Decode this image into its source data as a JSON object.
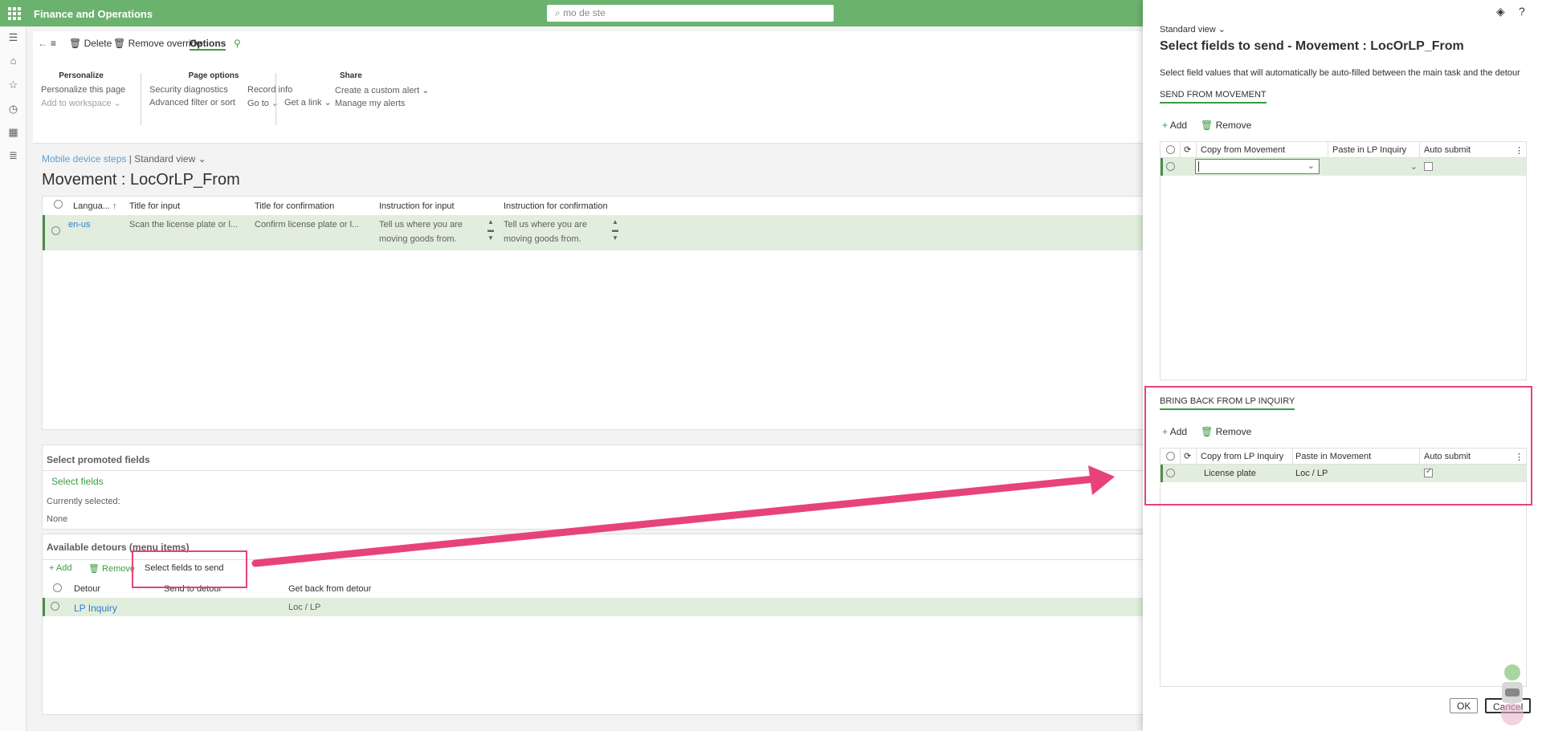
{
  "app": {
    "title": "Finance and Operations",
    "search_placeholder": "mo de ste"
  },
  "toolbar": {
    "delete": "Delete",
    "remove_override": "Remove override",
    "options": "Options"
  },
  "action_groups": {
    "personalize": {
      "header": "Personalize",
      "items": [
        "Personalize this page",
        "Add to workspace"
      ]
    },
    "page_options": {
      "header": "Page options",
      "col1": [
        "Security diagnostics",
        "Advanced filter or sort"
      ],
      "col2": [
        "Record info",
        "Go to"
      ]
    },
    "link": {
      "label": "Get a link"
    },
    "share": {
      "header": "Share",
      "items": [
        "Create a custom alert",
        "Manage my alerts"
      ]
    }
  },
  "breadcrumb": {
    "link": "Mobile device steps",
    "separator": "|",
    "view": "Standard view"
  },
  "page_title": "Movement : LocOrLP_From",
  "lang_grid": {
    "headers": [
      "Langua...",
      "Title for input",
      "Title for confirmation",
      "Instruction for input",
      "Instruction for confirmation"
    ],
    "row": [
      "en-us",
      "Scan the license plate or l...",
      "Confirm license plate or l...",
      "Tell us where you are",
      "moving goods from.",
      "Tell us where you are",
      "moving goods from."
    ]
  },
  "promoted": {
    "header": "Select promoted fields",
    "select_fields": "Select fields",
    "currently_label": "Currently selected:",
    "currently_value": "None"
  },
  "detours": {
    "header": "Available detours (menu items)",
    "add": "Add",
    "remove": "Remove",
    "select_fields_to_send": "Select fields to send",
    "columns": [
      "Detour",
      "Send to detour",
      "Get back from detour"
    ],
    "row": [
      "LP Inquiry",
      "",
      "Loc / LP"
    ]
  },
  "panel": {
    "view": "Standard view",
    "title": "Select fields to send - Movement : LocOrLP_From",
    "description": "Select field values that will automatically be auto-filled between the main task and the detour",
    "send_section": {
      "header": "SEND FROM MOVEMENT",
      "add": "Add",
      "remove": "Remove",
      "columns": [
        "Copy from Movement",
        "Paste in LP Inquiry",
        "Auto submit"
      ],
      "row": [
        "",
        "",
        false
      ]
    },
    "bring_section": {
      "header": "BRING BACK FROM LP INQUIRY",
      "add": "Add",
      "remove": "Remove",
      "columns": [
        "Copy from LP Inquiry",
        "Paste in Movement",
        "Auto submit"
      ],
      "row": [
        "License plate",
        "Loc / LP",
        true
      ]
    },
    "ok": "OK",
    "cancel": "Cancel"
  },
  "colors": {
    "topbar": "#6cb26f",
    "accent_green": "#3c9c40",
    "selected_row": "#e1eedd",
    "callout": "#e8427a"
  }
}
